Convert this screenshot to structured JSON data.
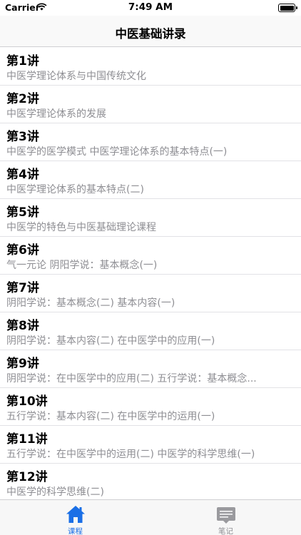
{
  "status_bar": {
    "carrier": "Carrier",
    "time": "7:49 AM"
  },
  "nav": {
    "title": "中医基础讲录"
  },
  "lessons": [
    {
      "title": "第1讲",
      "subtitle": "中医学理论体系与中国传统文化"
    },
    {
      "title": "第2讲",
      "subtitle": "中医学理论体系的发展"
    },
    {
      "title": "第3讲",
      "subtitle": "中医学的医学模式 中医学理论体系的基本特点(一)"
    },
    {
      "title": "第4讲",
      "subtitle": "中医学理论体系的基本特点(二)"
    },
    {
      "title": "第5讲",
      "subtitle": "中医学的特色与中医基础理论课程"
    },
    {
      "title": "第6讲",
      "subtitle": "气一元论 阴阳学说：基本概念(一)"
    },
    {
      "title": "第7讲",
      "subtitle": "阴阳学说：基本概念(二) 基本内容(一)"
    },
    {
      "title": "第8讲",
      "subtitle": "阴阳学说：基本内容(二) 在中医学中的应用(一)"
    },
    {
      "title": "第9讲",
      "subtitle": "阴阳学说：在中医学中的应用(二) 五行学说：基本概念..."
    },
    {
      "title": "第10讲",
      "subtitle": "五行学说：基本内容(二) 在中医学中的运用(一)"
    },
    {
      "title": "第11讲",
      "subtitle": "五行学说：在中医学中的运用(二) 中医学的科学思维(一)"
    },
    {
      "title": "第12讲",
      "subtitle": "中医学的科学思维(二)"
    }
  ],
  "tabs": {
    "home": {
      "label": "课程",
      "icon": "home-icon"
    },
    "notes": {
      "label": "笔记",
      "icon": "notebook-icon"
    }
  },
  "colors": {
    "accent": "#1a6fe6",
    "inactive": "#8e8e93",
    "subtitle": "#8e8e93"
  }
}
